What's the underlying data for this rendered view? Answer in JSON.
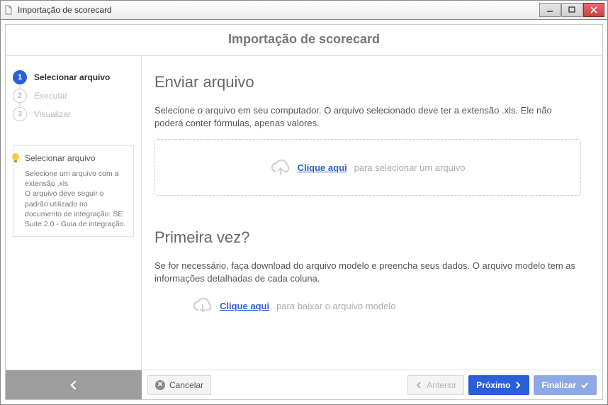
{
  "window": {
    "title": "Importação de scorecard"
  },
  "header": {
    "title": "Importação de scorecard"
  },
  "steps": [
    {
      "num": "1",
      "label": "Selecionar arquivo"
    },
    {
      "num": "2",
      "label": "Executar"
    },
    {
      "num": "3",
      "label": "Visualizar"
    }
  ],
  "tip": {
    "title": "Selecionar arquivo",
    "line1": "Selecione um arquivo com a extensão .xls",
    "line2": "O arquivo deve seguir o padrão utilizado no documento de integração: SE Suite 2.0 - Guia de integração."
  },
  "main": {
    "send_heading": "Enviar arquivo",
    "send_desc": "Selecione o arquivo em seu computador. O arquivo selecionado deve ter a extensão .xls. Ele não poderá conter fórmulas, apenas valores.",
    "drop_link": "Clique aqui",
    "drop_rest": "para selecionar um arquivo",
    "first_heading": "Primeira vez?",
    "first_desc": "Se for necessário, faça download do arquivo modelo e preencha seus dados. O arquivo modelo tem as informações detalhadas de cada coluna.",
    "download_link": "Clique aqui",
    "download_rest": "para baixar o arquivo modelo"
  },
  "footer": {
    "cancel": "Cancelar",
    "previous": "Anterior",
    "next": "Próximo",
    "finish": "Finalizar"
  }
}
